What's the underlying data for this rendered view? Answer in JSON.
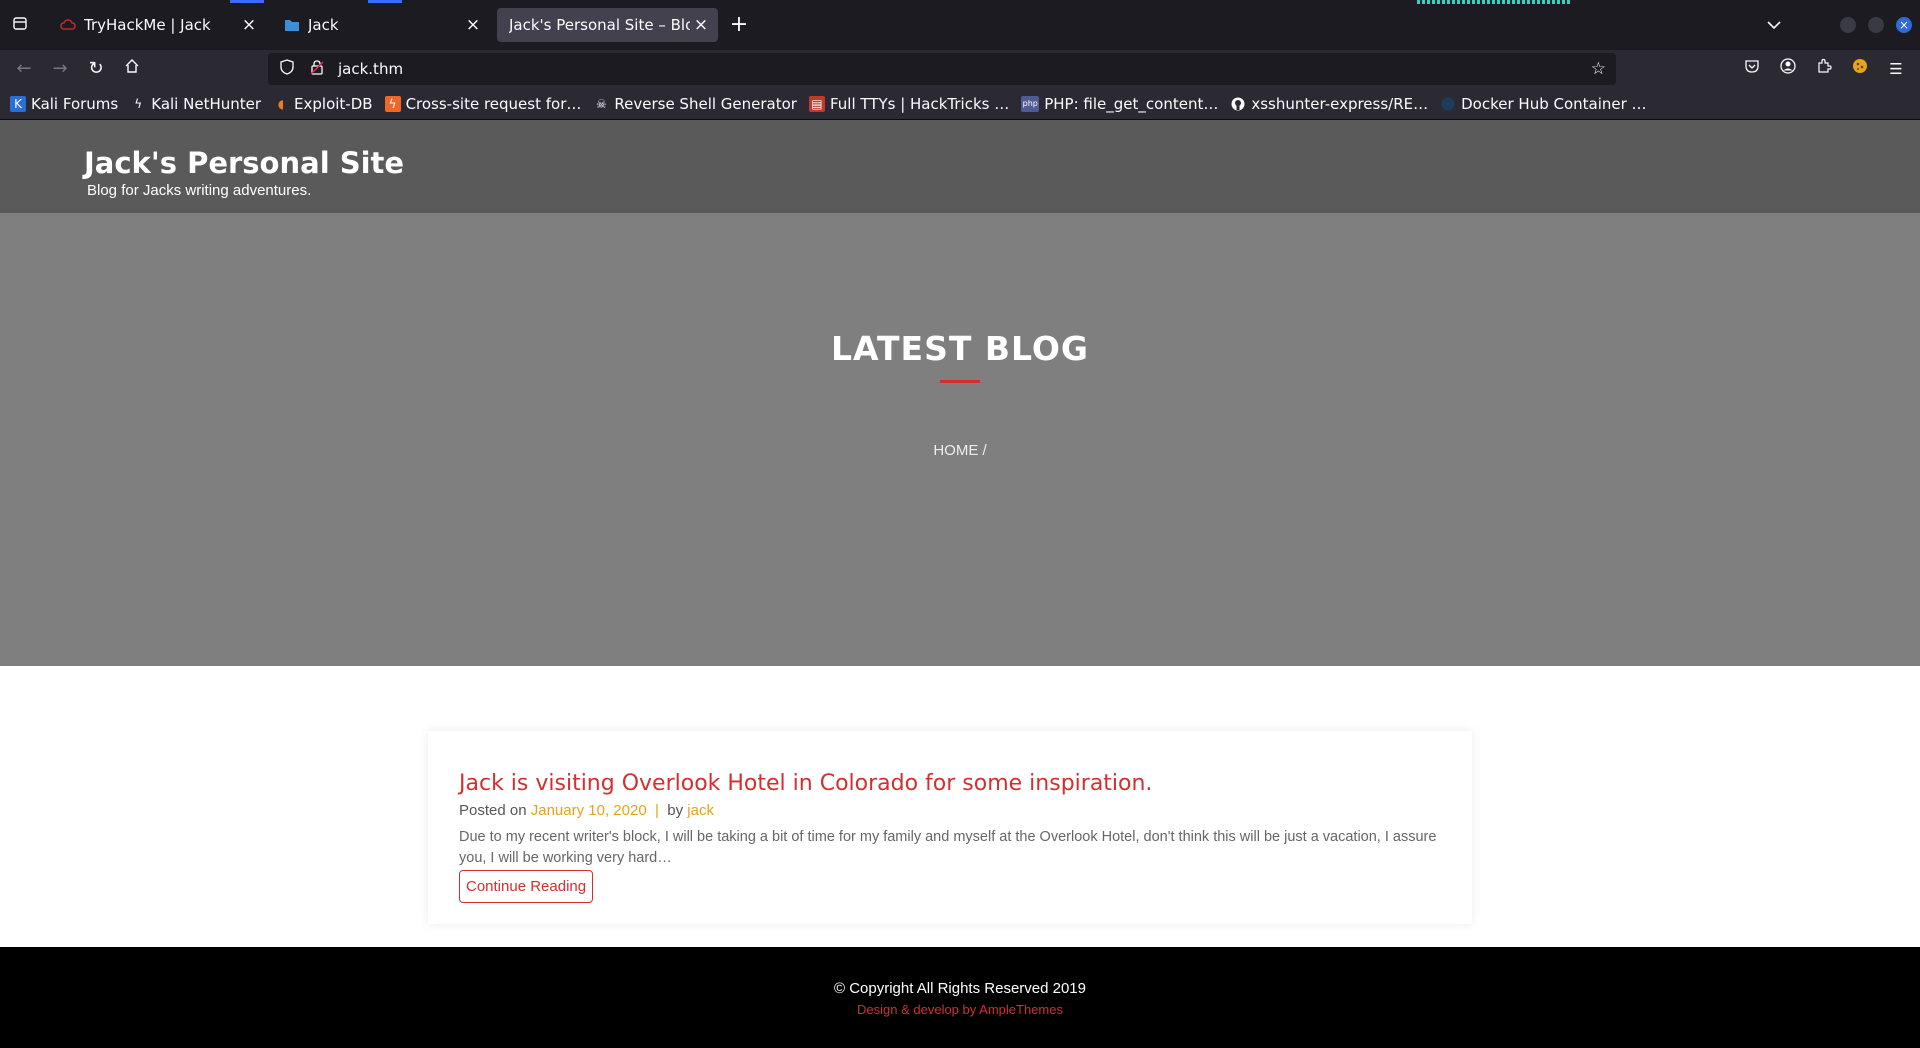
{
  "browser": {
    "tabs": [
      {
        "title": "TryHackMe | Jack",
        "icon": "tryhackme-cloud-icon"
      },
      {
        "title": "Jack",
        "icon": "folder-icon"
      },
      {
        "title": "Jack's Personal Site – Blog fo",
        "icon": ""
      }
    ],
    "url": "jack.thm",
    "bookmarks": [
      {
        "label": "Kali Forums",
        "icon": "kali-icon"
      },
      {
        "label": "Kali NetHunter",
        "icon": "nethunter-icon"
      },
      {
        "label": "Exploit-DB",
        "icon": "exploitdb-icon"
      },
      {
        "label": "Cross-site request for…",
        "icon": "portswigger-icon"
      },
      {
        "label": "Reverse Shell Generator",
        "icon": "skull-icon"
      },
      {
        "label": "Full TTYs | HackTricks …",
        "icon": "hacktricks-icon"
      },
      {
        "label": "PHP: file_get_content…",
        "icon": "php-icon"
      },
      {
        "label": "xsshunter-express/RE…",
        "icon": "github-icon"
      },
      {
        "label": "Docker Hub Container …",
        "icon": "docker-icon"
      }
    ],
    "php_badge": "php"
  },
  "site": {
    "title": "Jack's Personal Site",
    "tagline": "Blog for Jacks writing adventures."
  },
  "hero": {
    "title": "LATEST BLOG",
    "breadcrumb": "HOME /"
  },
  "post": {
    "title": "Jack is visiting Overlook Hotel in Colorado for some inspiration.",
    "posted_on_label": "Posted on",
    "date": "January 10, 2020",
    "separator": "|",
    "by_label": "by",
    "author": "jack",
    "excerpt": "Due to my recent writer's block, I will be taking a bit of time for my family and myself at the Overlook Hotel, don't think this will be just a vacation, I assure you, I will be working very hard…",
    "read_more": "Continue Reading"
  },
  "footer": {
    "copyright": "© Copyright All Rights Reserved 2019",
    "credits": "Design & develop by AmpleThemes"
  },
  "colors": {
    "accent": "#d32f2f",
    "meta_link": "#e8a31a",
    "header_bg": "#5a5a5a",
    "hero_bg": "#7f7f7f"
  }
}
